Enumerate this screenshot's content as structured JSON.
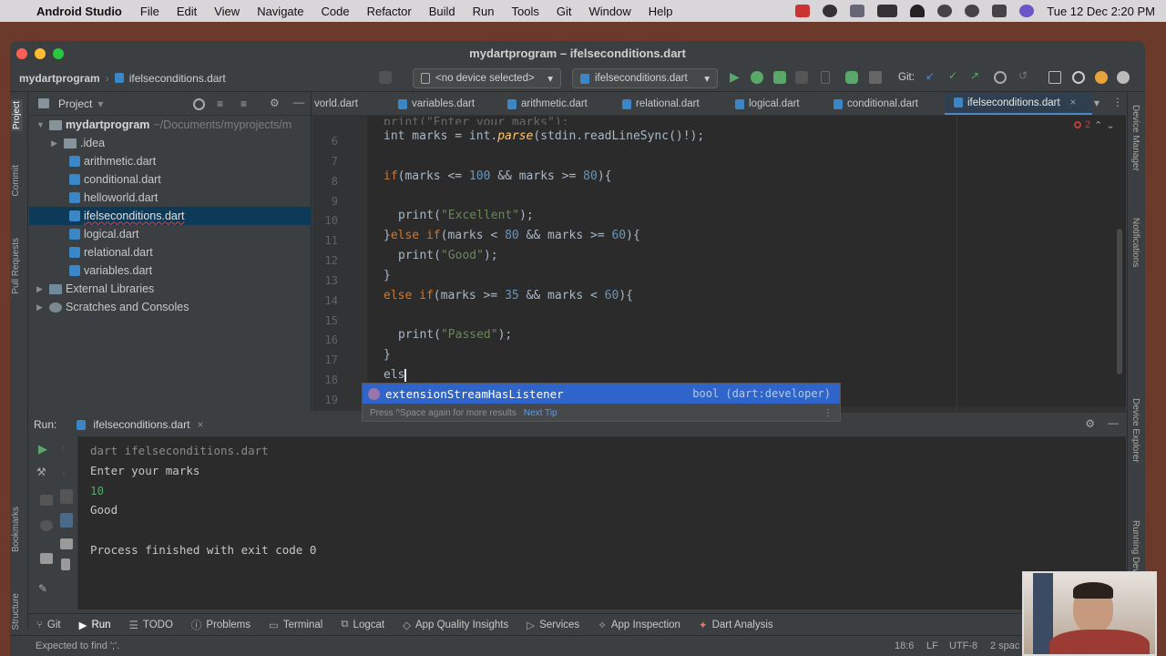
{
  "menubar": {
    "app": "Android Studio",
    "items": [
      "File",
      "Edit",
      "View",
      "Navigate",
      "Code",
      "Refactor",
      "Build",
      "Run",
      "Tools",
      "Git",
      "Window",
      "Help"
    ],
    "datetime": "Tue 12 Dec  2:20 PM"
  },
  "window": {
    "title": "mydartprogram – ifelseconditions.dart",
    "breadcrumb": [
      "mydartprogram",
      "ifelseconditions.dart"
    ],
    "device_combo": "<no device selected>",
    "config_combo": "ifelseconditions.dart",
    "git_label": "Git:"
  },
  "project": {
    "title": "Project",
    "root": "mydartprogram",
    "root_path": "~/Documents/myprojects/m",
    "items": [
      ".idea",
      "arithmetic.dart",
      "conditional.dart",
      "helloworld.dart",
      "ifelseconditions.dart",
      "logical.dart",
      "relational.dart",
      "variables.dart"
    ],
    "external": "External Libraries",
    "scratches": "Scratches and Consoles"
  },
  "left_strip": [
    "Project",
    "Commit",
    "Pull Requests",
    "Bookmarks",
    "Structure"
  ],
  "right_strip": [
    "Device Manager",
    "Notifications",
    "Device Explorer",
    "Running Devices"
  ],
  "editor": {
    "tabs": [
      "vorld.dart",
      "variables.dart",
      "arithmetic.dart",
      "relational.dart",
      "logical.dart",
      "conditional.dart",
      "ifelseconditions.dart"
    ],
    "active_tab": "ifelseconditions.dart",
    "warning_count": "2",
    "lines": [
      "6",
      "7",
      "8",
      "9",
      "10",
      "11",
      "12",
      "13",
      "14",
      "15",
      "16",
      "17",
      "18",
      "19"
    ],
    "top_partial": "print(\"Enter your marks\");",
    "code": {
      "l6_a": "int marks = int.",
      "l6_fn": "parse",
      "l6_b": "(stdin.readLineSync()!);",
      "l8_kw": "if",
      "l8_a": "(marks <= ",
      "l8_n1": "100",
      "l8_b": " && marks >= ",
      "l8_n2": "80",
      "l8_c": "){",
      "l10_a": "print(",
      "l10_s": "\"Excellent\"",
      "l10_b": ");",
      "l11_a": "}",
      "l11_kw": "else if",
      "l11_b": "(marks < ",
      "l11_n1": "80",
      "l11_c": " && marks >= ",
      "l11_n2": "60",
      "l11_d": "){",
      "l12_a": "print(",
      "l12_s": "\"Good\"",
      "l12_b": ");",
      "l13": "}",
      "l14_kw": "else if",
      "l14_a": "(marks >= ",
      "l14_n1": "35",
      "l14_b": " && marks < ",
      "l14_n2": "60",
      "l14_c": "){",
      "l16_a": "print(",
      "l16_s": "\"Passed\"",
      "l16_b": ");",
      "l17": "}",
      "l18": "els"
    }
  },
  "autocomplete": {
    "item": "extensionStreamHasListener",
    "type": "bool (dart:developer)",
    "hint": "Press ^Space again for more results",
    "next_tip": "Next Tip"
  },
  "run": {
    "label": "Run:",
    "tab": "ifelseconditions.dart",
    "output": [
      "dart ifelseconditions.dart",
      "Enter your marks",
      "10",
      "Good",
      "",
      "Process finished with exit code 0"
    ]
  },
  "bottom_tools": [
    "Git",
    "Run",
    "TODO",
    "Problems",
    "Terminal",
    "Logcat",
    "App Quality Insights",
    "Services",
    "App Inspection",
    "Dart Analysis"
  ],
  "status": {
    "message": "Expected to find ';'.",
    "position": "18:6",
    "line_sep": "LF",
    "encoding": "UTF-8",
    "indent": "2 spac"
  },
  "colors": {
    "accent": "#4a88c7",
    "keyword": "#cc7832",
    "number": "#6897bb",
    "string": "#6a8759",
    "run_green": "#59a869"
  }
}
